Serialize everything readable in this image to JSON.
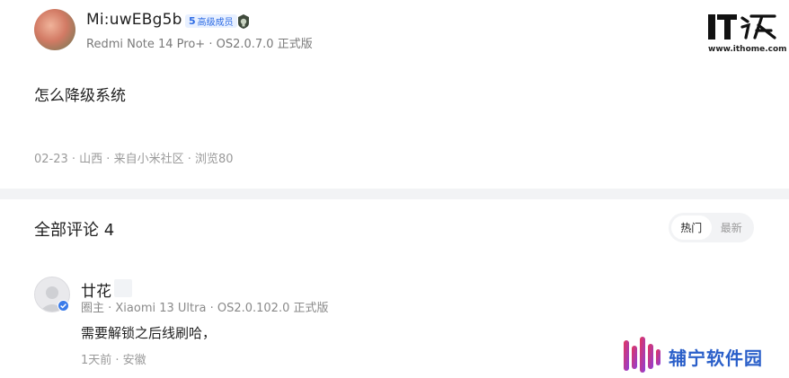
{
  "post": {
    "author": "Mi:uwEBg5b",
    "level_badge": {
      "level": "5",
      "label": "高级成员"
    },
    "device": "Redmi Note 14 Pro+ · OS2.0.7.0 正式版",
    "content": "怎么降级系统",
    "meta": "02-23 · 山西 · 来自小米社区 · 浏览80"
  },
  "comments_section": {
    "title": "全部评论 4",
    "sort": {
      "hot": "热门",
      "latest": "最新",
      "active": "hot"
    }
  },
  "comment": {
    "author": "廿花",
    "sub": "圈主 · Xiaomi 13 Ultra · OS2.0.102.0 正式版",
    "text": "需要解锁之后线刷哈，",
    "meta": "1天前 · 安徽"
  },
  "watermarks": {
    "ithome_logo": "IT之家",
    "ithome_url": "www.ithome.com",
    "fuyu_text": "辅宁软件园"
  },
  "colors": {
    "accent_blue": "#2d6be4",
    "divider": "#f2f3f5",
    "muted_text": "#9a9a9a"
  }
}
